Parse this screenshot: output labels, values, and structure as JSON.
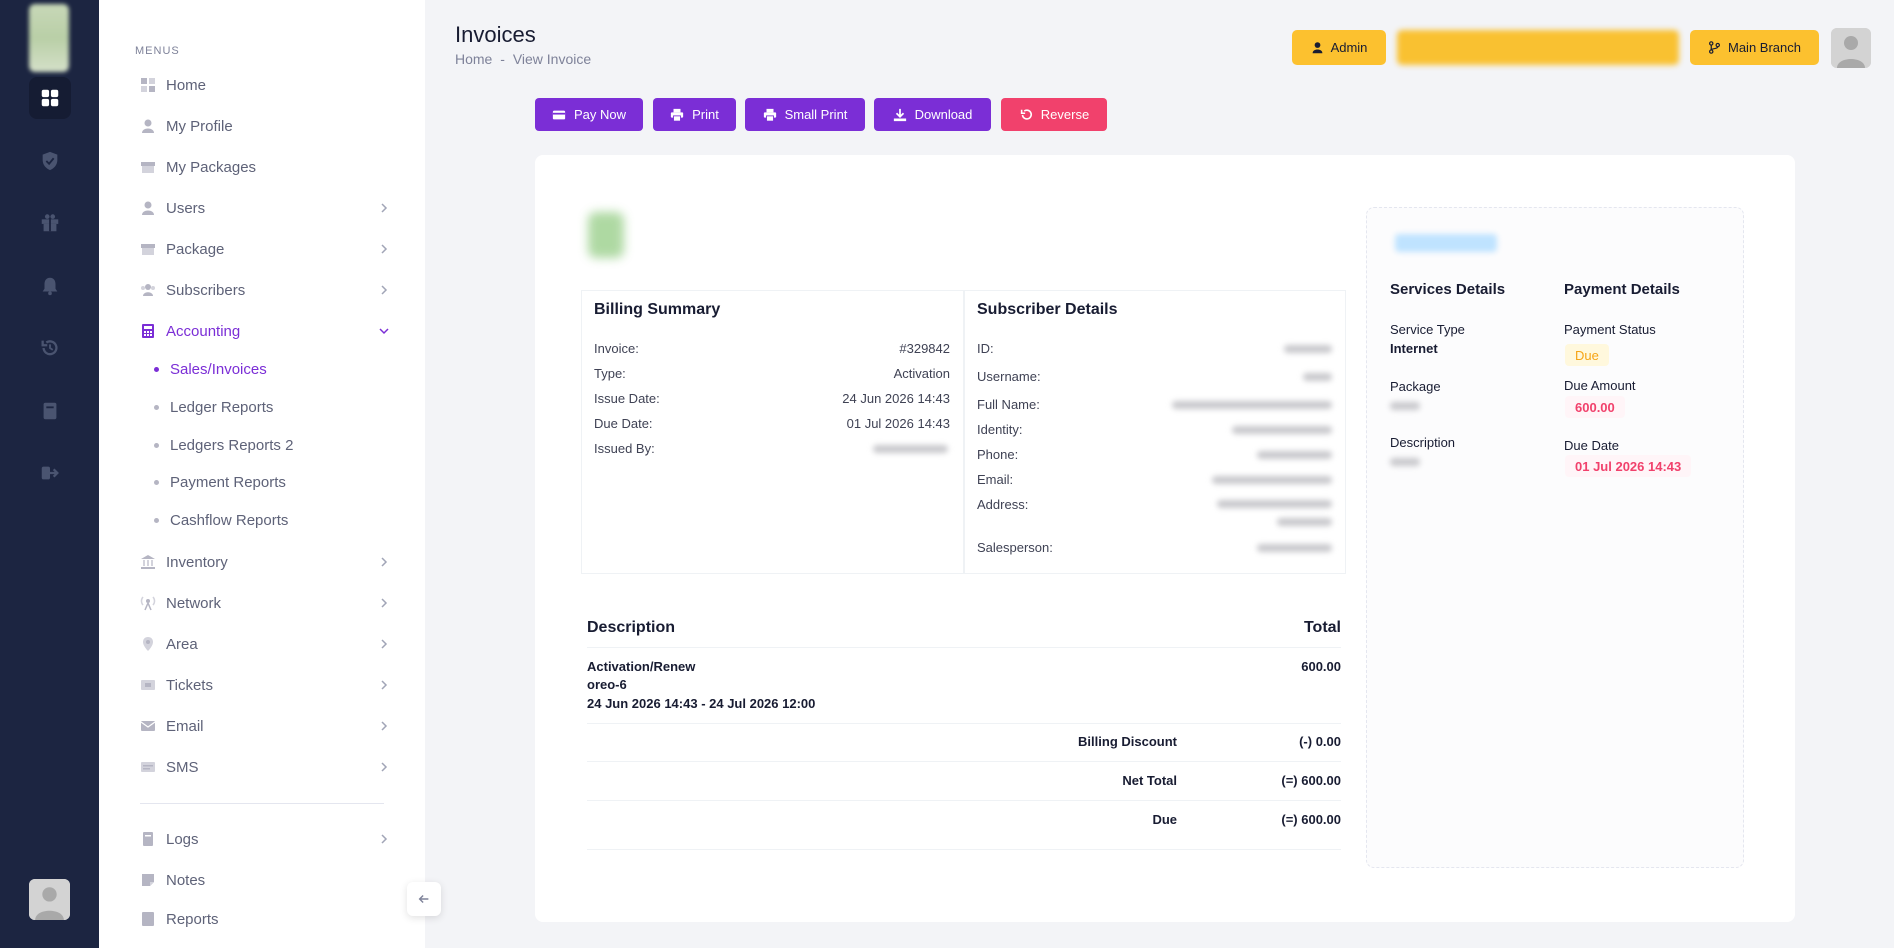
{
  "rail": {
    "icons": [
      "dashboard-icon",
      "shield-check-icon",
      "gift-icon",
      "bell-icon",
      "history-icon",
      "book-icon",
      "logout-icon"
    ]
  },
  "menu": {
    "section_title": "MENUS",
    "items": [
      {
        "label": "Home",
        "icon": "home-icon"
      },
      {
        "label": "My Profile",
        "icon": "user-icon"
      },
      {
        "label": "My Packages",
        "icon": "box-icon"
      },
      {
        "label": "Users",
        "icon": "user-icon"
      },
      {
        "label": "Package",
        "icon": "box-icon"
      },
      {
        "label": "Subscribers",
        "icon": "group-icon"
      },
      {
        "label": "Accounting",
        "icon": "calculator-icon"
      },
      {
        "label": "Inventory",
        "icon": "bank-icon"
      },
      {
        "label": "Network",
        "icon": "antenna-icon"
      },
      {
        "label": "Area",
        "icon": "map-pin-icon"
      },
      {
        "label": "Tickets",
        "icon": "ticket-icon"
      },
      {
        "label": "Email",
        "icon": "envelope-icon"
      },
      {
        "label": "SMS",
        "icon": "sms-icon"
      },
      {
        "label": "Logs",
        "icon": "book-icon"
      },
      {
        "label": "Notes",
        "icon": "note-icon"
      },
      {
        "label": "Reports",
        "icon": "report-icon"
      }
    ],
    "accounting_sub": [
      {
        "label": "Sales/Invoices"
      },
      {
        "label": "Ledger Reports"
      },
      {
        "label": "Ledgers Reports 2"
      },
      {
        "label": "Payment Reports"
      },
      {
        "label": "Cashflow Reports"
      }
    ]
  },
  "header": {
    "title": "Invoices",
    "breadcrumb": [
      "Home",
      "-",
      "View Invoice"
    ],
    "admin_label": "Admin",
    "branch_label": "Main Branch"
  },
  "actions": {
    "pay_now": "Pay Now",
    "print": "Print",
    "small_print": "Small Print",
    "download": "Download",
    "reverse": "Reverse"
  },
  "billing": {
    "title": "Billing Summary",
    "invoice_label": "Invoice:",
    "invoice_value": "#329842",
    "type_label": "Type:",
    "type_value": "Activation",
    "issue_label": "Issue Date:",
    "issue_value": "24 Jun 2026 14:43",
    "due_label": "Due Date:",
    "due_value": "01 Jul 2026 14:43",
    "issued_by_label": "Issued By:"
  },
  "subscriber": {
    "title": "Subscriber Details",
    "labels": [
      "ID:",
      "Username:",
      "Full Name:",
      "Identity:",
      "Phone:",
      "Email:",
      "Address:",
      "Salesperson:"
    ]
  },
  "items": {
    "desc_header": "Description",
    "total_header": "Total",
    "line1": "Activation/Renew",
    "line2": "oreo-6",
    "line3": "24 Jun 2026 14:43 - 24 Jul 2026 12:00",
    "line_total": "600.00",
    "discount_label": "Billing Discount",
    "discount_value": "(-) 0.00",
    "net_label": "Net Total",
    "net_value": "(=) 600.00",
    "due_label": "Due",
    "due_value": "(=) 600.00"
  },
  "summary": {
    "services_title": "Services Details",
    "payment_title": "Payment Details",
    "service_type_label": "Service Type",
    "service_type_value": "Internet",
    "package_label": "Package",
    "description_label": "Description",
    "payment_status_label": "Payment Status",
    "payment_status_value": "Due",
    "due_amount_label": "Due Amount",
    "due_amount_value": "600.00",
    "due_date_label": "Due Date",
    "due_date_value": "01 Jul 2026 14:43"
  },
  "colors": {
    "rail_bg": "#1c2541",
    "accent_purple": "#7b2ed6",
    "reverse_red": "#f1416c",
    "header_yellow": "#fcc12f"
  }
}
